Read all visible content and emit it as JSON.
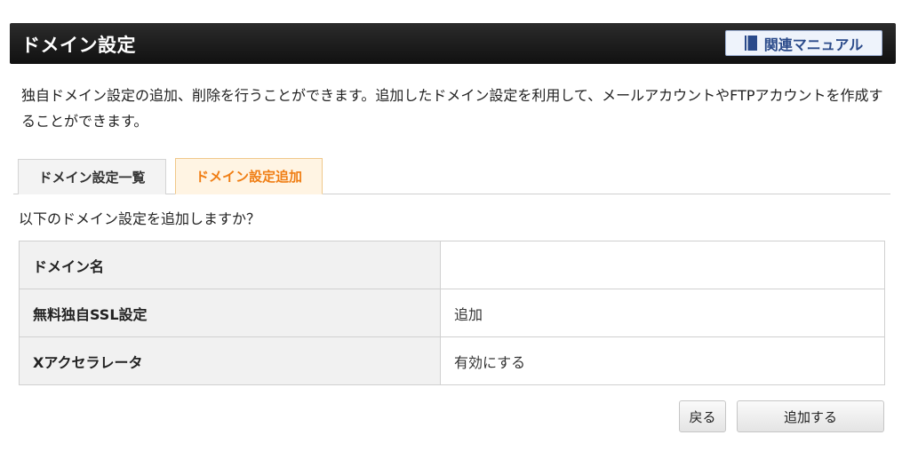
{
  "header": {
    "title": "ドメイン設定",
    "manual_label": "関連マニュアル"
  },
  "description": "独自ドメイン設定の追加、削除を行うことができます。追加したドメイン設定を利用して、メールアカウントやFTPアカウントを作成することができます。",
  "tabs": [
    {
      "label": "ドメイン設定一覧",
      "active": false
    },
    {
      "label": "ドメイン設定追加",
      "active": true
    }
  ],
  "confirm_text": "以下のドメイン設定を追加しますか？",
  "table": {
    "rows": [
      {
        "label": "ドメイン名",
        "value": ""
      },
      {
        "label": "無料独自SSL設定",
        "value": "追加"
      },
      {
        "label": "Xアクセラレータ",
        "value": "有効にする"
      }
    ]
  },
  "buttons": {
    "back_label": "戻る",
    "submit_label": "追加する"
  },
  "colors": {
    "active_tab_text": "#f07e14",
    "manual_text": "#2a4a8a"
  }
}
